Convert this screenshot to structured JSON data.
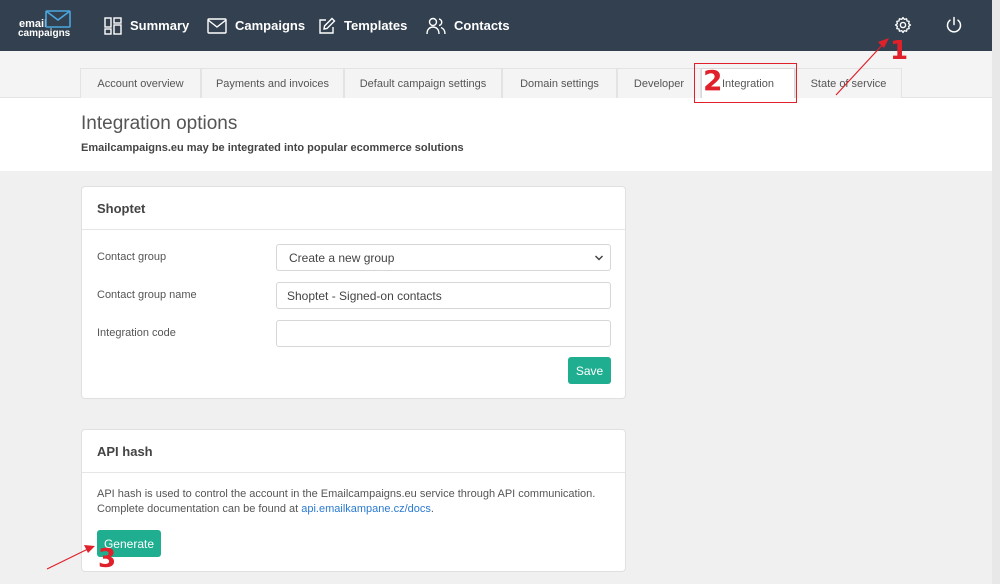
{
  "logo": {
    "line1": "email",
    "line2": "campaigns"
  },
  "nav": [
    {
      "label": "Summary",
      "icon": "dashboard-icon"
    },
    {
      "label": "Campaigns",
      "icon": "envelope-icon"
    },
    {
      "label": "Templates",
      "icon": "edit-icon"
    },
    {
      "label": "Contacts",
      "icon": "users-icon"
    }
  ],
  "top_icons": [
    "gear-icon",
    "power-icon"
  ],
  "tabs": [
    {
      "label": "Account overview",
      "active": false
    },
    {
      "label": "Payments and invoices",
      "active": false
    },
    {
      "label": "Default campaign settings",
      "active": false
    },
    {
      "label": "Domain settings",
      "active": false
    },
    {
      "label": "Developer",
      "active": false
    },
    {
      "label": "Integration",
      "active": true
    },
    {
      "label": "State of service",
      "active": false
    }
  ],
  "header": {
    "title": "Integration options",
    "subtitle": "Emailcampaigns.eu may be integrated into popular ecommerce solutions"
  },
  "shoptet": {
    "title": "Shoptet",
    "contact_group_label": "Contact group",
    "contact_group_value": "Create a new group",
    "group_name_label": "Contact group name",
    "group_name_value": "Shoptet - Signed-on contacts",
    "integration_code_label": "Integration code",
    "integration_code_value": "",
    "save_label": "Save"
  },
  "api_hash": {
    "title": "API hash",
    "description": "API hash is used to control the account in the Emailcampaigns.eu service through API communication. Complete documentation can be found at ",
    "docs_link": "api.emailkampane.cz/docs",
    "description_end": ".",
    "generate_label": "Generate"
  },
  "annotations": {
    "n1": "1",
    "n2": "2",
    "n3": "3"
  },
  "colors": {
    "nav_bg": "#33404f",
    "accent": "#1fae8f",
    "annotation": "#e0202a",
    "link": "#2a7ad1"
  }
}
